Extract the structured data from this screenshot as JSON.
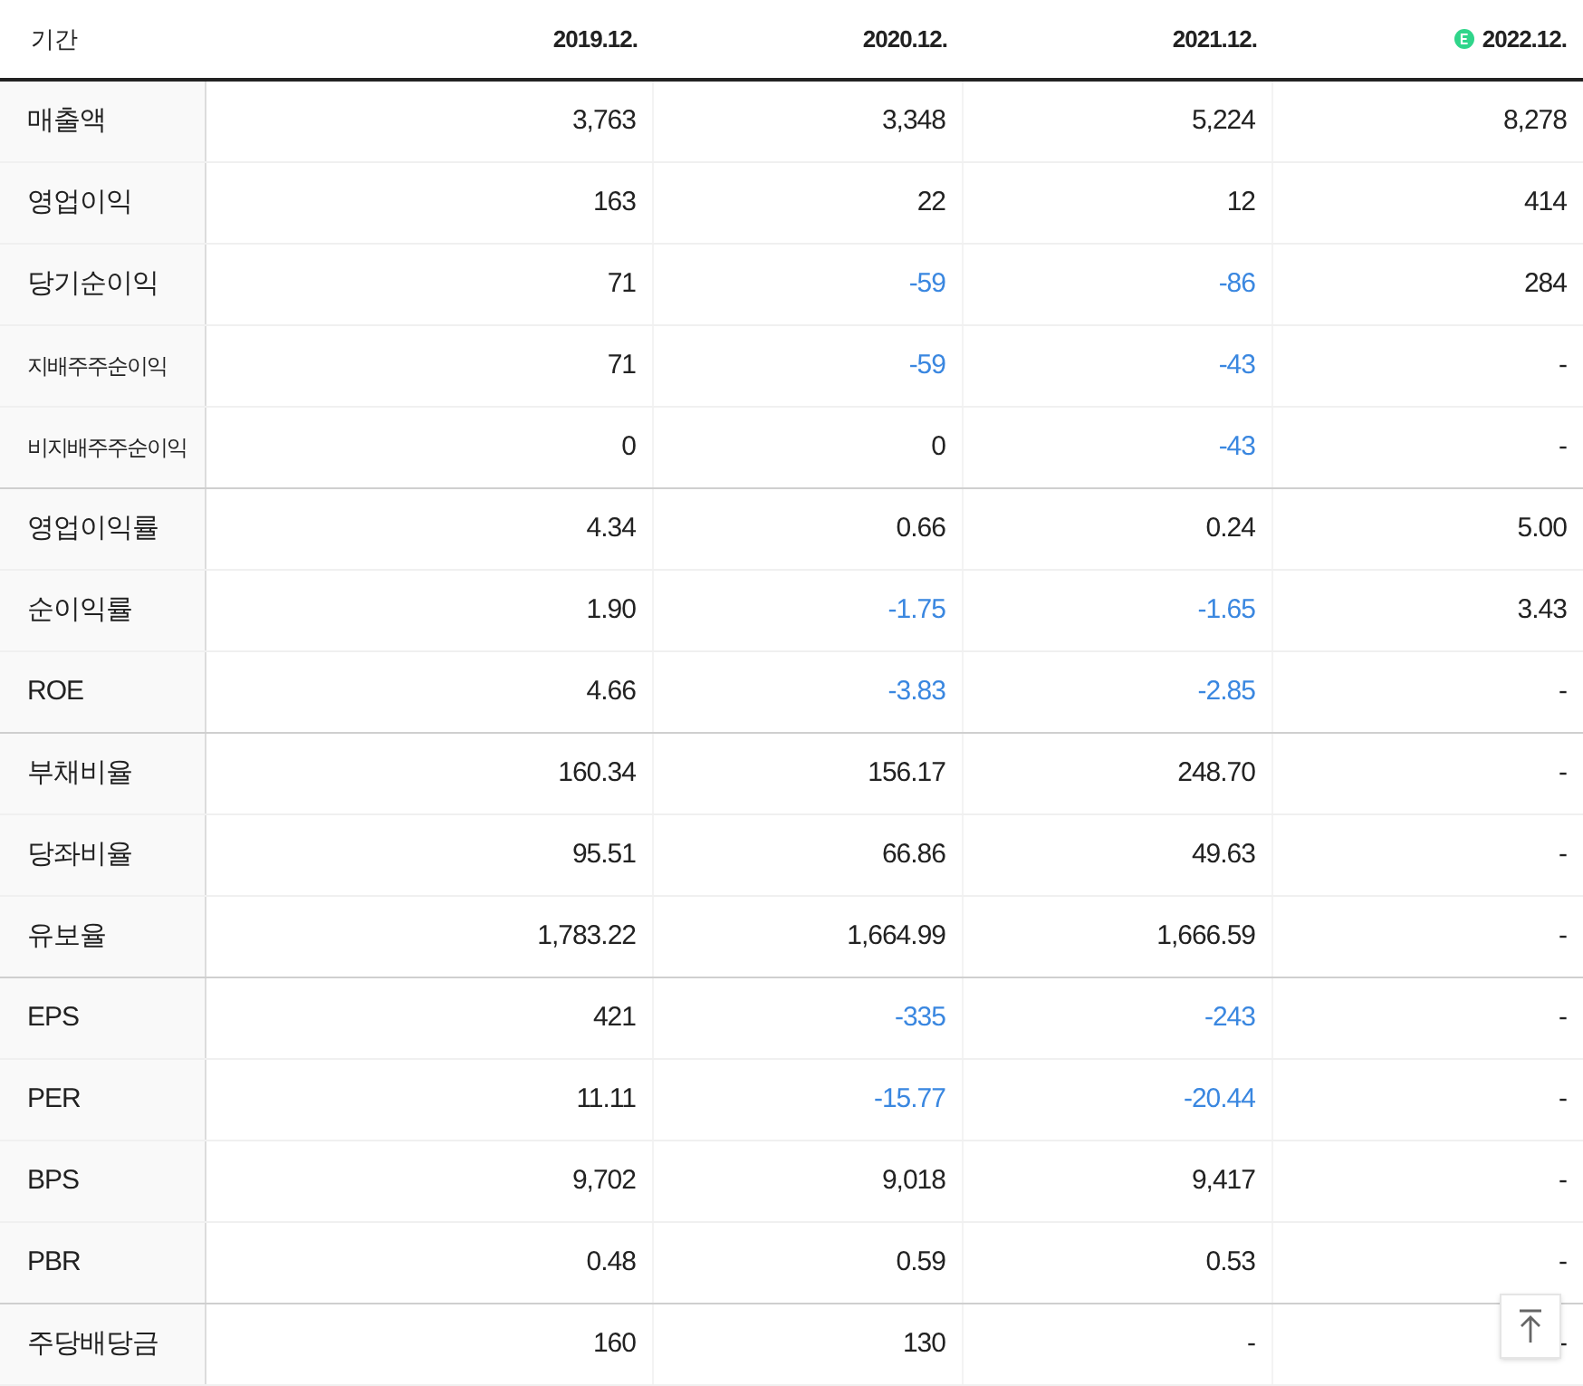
{
  "header": {
    "label": "기간",
    "columns": [
      {
        "text": "2019.12.",
        "estimate": false
      },
      {
        "text": "2020.12.",
        "estimate": false
      },
      {
        "text": "2021.12.",
        "estimate": false
      },
      {
        "text": "2022.12.",
        "estimate": true
      }
    ]
  },
  "rows": [
    {
      "label": "매출액",
      "kind": "main",
      "divider_below": false,
      "cells": [
        {
          "text": "3,763",
          "negative": false
        },
        {
          "text": "3,348",
          "negative": false
        },
        {
          "text": "5,224",
          "negative": false
        },
        {
          "text": "8,278",
          "negative": false
        }
      ]
    },
    {
      "label": "영업이익",
      "kind": "main",
      "divider_below": false,
      "cells": [
        {
          "text": "163",
          "negative": false
        },
        {
          "text": "22",
          "negative": false
        },
        {
          "text": "12",
          "negative": false
        },
        {
          "text": "414",
          "negative": false
        }
      ]
    },
    {
      "label": "당기순이익",
      "kind": "main",
      "divider_below": false,
      "cells": [
        {
          "text": "71",
          "negative": false
        },
        {
          "text": "-59",
          "negative": true
        },
        {
          "text": "-86",
          "negative": true
        },
        {
          "text": "284",
          "negative": false
        }
      ]
    },
    {
      "label": "지배주주순이익",
      "kind": "sub",
      "divider_below": false,
      "cells": [
        {
          "text": "71",
          "negative": false
        },
        {
          "text": "-59",
          "negative": true
        },
        {
          "text": "-43",
          "negative": true
        },
        {
          "text": "-",
          "negative": false
        }
      ]
    },
    {
      "label": "비지배주주순이익",
      "kind": "sub",
      "divider_below": true,
      "cells": [
        {
          "text": "0",
          "negative": false
        },
        {
          "text": "0",
          "negative": false
        },
        {
          "text": "-43",
          "negative": true
        },
        {
          "text": "-",
          "negative": false
        }
      ]
    },
    {
      "label": "영업이익률",
      "kind": "main",
      "divider_below": false,
      "cells": [
        {
          "text": "4.34",
          "negative": false
        },
        {
          "text": "0.66",
          "negative": false
        },
        {
          "text": "0.24",
          "negative": false
        },
        {
          "text": "5.00",
          "negative": false
        }
      ]
    },
    {
      "label": "순이익률",
      "kind": "main",
      "divider_below": false,
      "cells": [
        {
          "text": "1.90",
          "negative": false
        },
        {
          "text": "-1.75",
          "negative": true
        },
        {
          "text": "-1.65",
          "negative": true
        },
        {
          "text": "3.43",
          "negative": false
        }
      ]
    },
    {
      "label": "ROE",
      "kind": "main",
      "divider_below": true,
      "cells": [
        {
          "text": "4.66",
          "negative": false
        },
        {
          "text": "-3.83",
          "negative": true
        },
        {
          "text": "-2.85",
          "negative": true
        },
        {
          "text": "-",
          "negative": false
        }
      ]
    },
    {
      "label": "부채비율",
      "kind": "main",
      "divider_below": false,
      "cells": [
        {
          "text": "160.34",
          "negative": false
        },
        {
          "text": "156.17",
          "negative": false
        },
        {
          "text": "248.70",
          "negative": false
        },
        {
          "text": "-",
          "negative": false
        }
      ]
    },
    {
      "label": "당좌비율",
      "kind": "main",
      "divider_below": false,
      "cells": [
        {
          "text": "95.51",
          "negative": false
        },
        {
          "text": "66.86",
          "negative": false
        },
        {
          "text": "49.63",
          "negative": false
        },
        {
          "text": "-",
          "negative": false
        }
      ]
    },
    {
      "label": "유보율",
      "kind": "main",
      "divider_below": true,
      "cells": [
        {
          "text": "1,783.22",
          "negative": false
        },
        {
          "text": "1,664.99",
          "negative": false
        },
        {
          "text": "1,666.59",
          "negative": false
        },
        {
          "text": "-",
          "negative": false
        }
      ]
    },
    {
      "label": "EPS",
      "kind": "main",
      "divider_below": false,
      "cells": [
        {
          "text": "421",
          "negative": false
        },
        {
          "text": "-335",
          "negative": true
        },
        {
          "text": "-243",
          "negative": true
        },
        {
          "text": "-",
          "negative": false
        }
      ]
    },
    {
      "label": "PER",
      "kind": "main",
      "divider_below": false,
      "cells": [
        {
          "text": "11.11",
          "negative": false
        },
        {
          "text": "-15.77",
          "negative": true
        },
        {
          "text": "-20.44",
          "negative": true
        },
        {
          "text": "-",
          "negative": false
        }
      ]
    },
    {
      "label": "BPS",
      "kind": "main",
      "divider_below": false,
      "cells": [
        {
          "text": "9,702",
          "negative": false
        },
        {
          "text": "9,018",
          "negative": false
        },
        {
          "text": "9,417",
          "negative": false
        },
        {
          "text": "-",
          "negative": false
        }
      ]
    },
    {
      "label": "PBR",
      "kind": "main",
      "divider_below": true,
      "cells": [
        {
          "text": "0.48",
          "negative": false
        },
        {
          "text": "0.59",
          "negative": false
        },
        {
          "text": "0.53",
          "negative": false
        },
        {
          "text": "-",
          "negative": false
        }
      ]
    },
    {
      "label": "주당배당금",
      "kind": "main",
      "divider_below": false,
      "cells": [
        {
          "text": "160",
          "negative": false
        },
        {
          "text": "130",
          "negative": false
        },
        {
          "text": "-",
          "negative": false
        },
        {
          "text": "-",
          "negative": false
        }
      ]
    }
  ]
}
